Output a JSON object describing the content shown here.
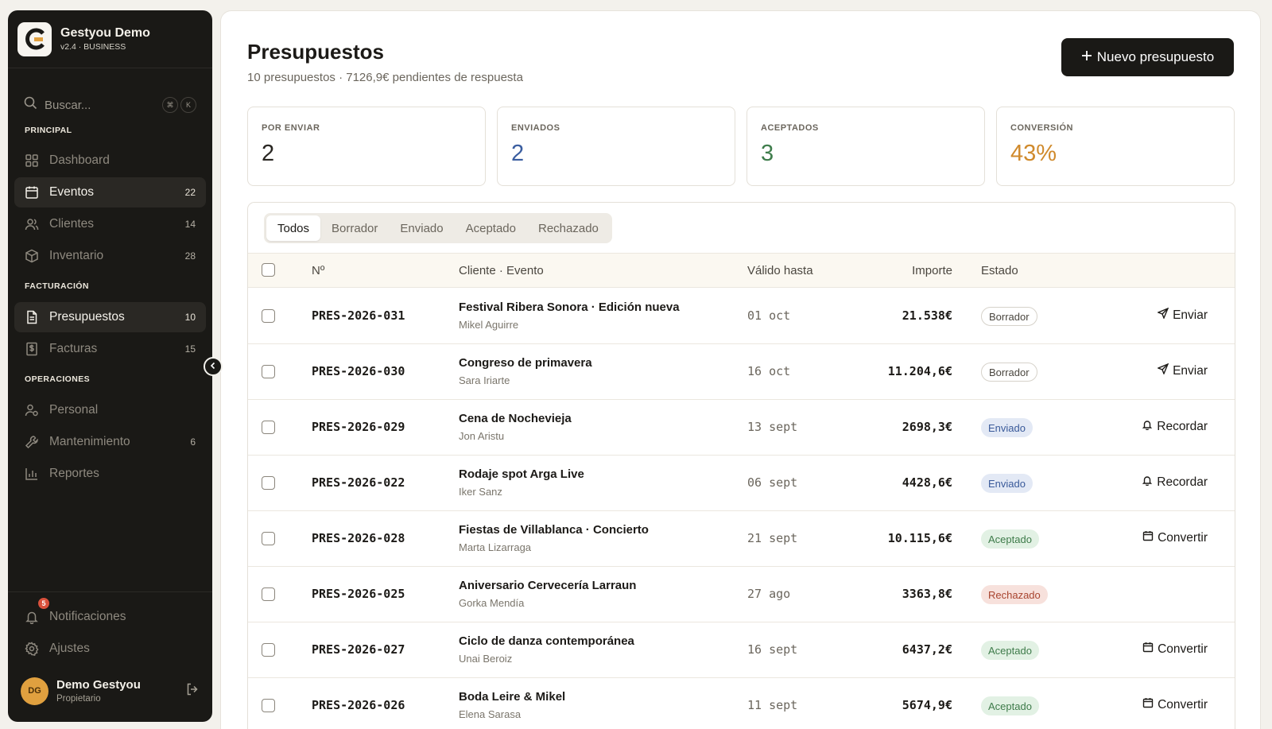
{
  "brand": {
    "name": "Gestyou Demo",
    "version": "v2.4 · BUSINESS"
  },
  "search": {
    "placeholder": "Buscar...",
    "kbd1": "⌘",
    "kbd2": "K"
  },
  "sidebar": {
    "sections": [
      "PRINCIPAL",
      "FACTURACIÓN",
      "OPERACIONES"
    ],
    "items": [
      {
        "label": "Dashboard",
        "count": ""
      },
      {
        "label": "Eventos",
        "count": "22"
      },
      {
        "label": "Clientes",
        "count": "14"
      },
      {
        "label": "Inventario",
        "count": "28"
      },
      {
        "label": "Presupuestos",
        "count": "10"
      },
      {
        "label": "Facturas",
        "count": "15"
      },
      {
        "label": "Personal",
        "count": ""
      },
      {
        "label": "Mantenimiento",
        "count": "6"
      },
      {
        "label": "Reportes",
        "count": ""
      }
    ],
    "notifications": {
      "label": "Notificaciones",
      "badge": "5"
    },
    "settings": {
      "label": "Ajustes"
    },
    "user": {
      "initials": "DG",
      "name": "Demo Gestyou",
      "role": "Propietario"
    }
  },
  "header": {
    "title": "Presupuestos",
    "subtitle": "10 presupuestos · 7126,9€ pendientes de respuesta",
    "new_button": "Nuevo presupuesto"
  },
  "stats": [
    {
      "label": "POR ENVIAR",
      "value": "2",
      "color": "#2a2723"
    },
    {
      "label": "ENVIADOS",
      "value": "2",
      "color": "#3b5ea0"
    },
    {
      "label": "ACEPTADOS",
      "value": "3",
      "color": "#3f7d4c"
    },
    {
      "label": "CONVERSIÓN",
      "value": "43%",
      "color": "#d08a2c"
    }
  ],
  "tabs": [
    "Todos",
    "Borrador",
    "Enviado",
    "Aceptado",
    "Rechazado"
  ],
  "table": {
    "headers": {
      "num": "Nº",
      "client": "Cliente · Evento",
      "valid": "Válido hasta",
      "amount": "Importe",
      "status": "Estado"
    },
    "rows": [
      {
        "num": "PRES-2026-031",
        "event": "Festival Ribera Sonora · Edición nueva",
        "client": "Mikel Aguirre",
        "date": "01 oct",
        "amount": "21.538€",
        "status": "Borrador",
        "status_key": "borrador",
        "action": "Enviar",
        "action_icon": "send-icon"
      },
      {
        "num": "PRES-2026-030",
        "event": "Congreso de primavera",
        "client": "Sara Iriarte",
        "date": "16 oct",
        "amount": "11.204,6€",
        "status": "Borrador",
        "status_key": "borrador",
        "action": "Enviar",
        "action_icon": "send-icon"
      },
      {
        "num": "PRES-2026-029",
        "event": "Cena de Nochevieja",
        "client": "Jon Aristu",
        "date": "13 sept",
        "amount": "2698,3€",
        "status": "Enviado",
        "status_key": "enviado",
        "action": "Recordar",
        "action_icon": "bell-icon"
      },
      {
        "num": "PRES-2026-022",
        "event": "Rodaje spot Arga Live",
        "client": "Iker Sanz",
        "date": "06 sept",
        "amount": "4428,6€",
        "status": "Enviado",
        "status_key": "enviado",
        "action": "Recordar",
        "action_icon": "bell-icon"
      },
      {
        "num": "PRES-2026-028",
        "event": "Fiestas de Villablanca · Concierto",
        "client": "Marta Lizarraga",
        "date": "21 sept",
        "amount": "10.115,6€",
        "status": "Aceptado",
        "status_key": "aceptado",
        "action": "Convertir",
        "action_icon": "calendar-icon"
      },
      {
        "num": "PRES-2026-025",
        "event": "Aniversario Cervecería Larraun",
        "client": "Gorka Mendía",
        "date": "27 ago",
        "amount": "3363,8€",
        "status": "Rechazado",
        "status_key": "rechazado",
        "action": "",
        "action_icon": ""
      },
      {
        "num": "PRES-2026-027",
        "event": "Ciclo de danza contemporánea",
        "client": "Unai Beroiz",
        "date": "16 sept",
        "amount": "6437,2€",
        "status": "Aceptado",
        "status_key": "aceptado",
        "action": "Convertir",
        "action_icon": "calendar-icon"
      },
      {
        "num": "PRES-2026-026",
        "event": "Boda Leire & Mikel",
        "client": "Elena Sarasa",
        "date": "11 sept",
        "amount": "5674,9€",
        "status": "Aceptado",
        "status_key": "aceptado",
        "action": "Convertir",
        "action_icon": "calendar-icon"
      }
    ]
  }
}
